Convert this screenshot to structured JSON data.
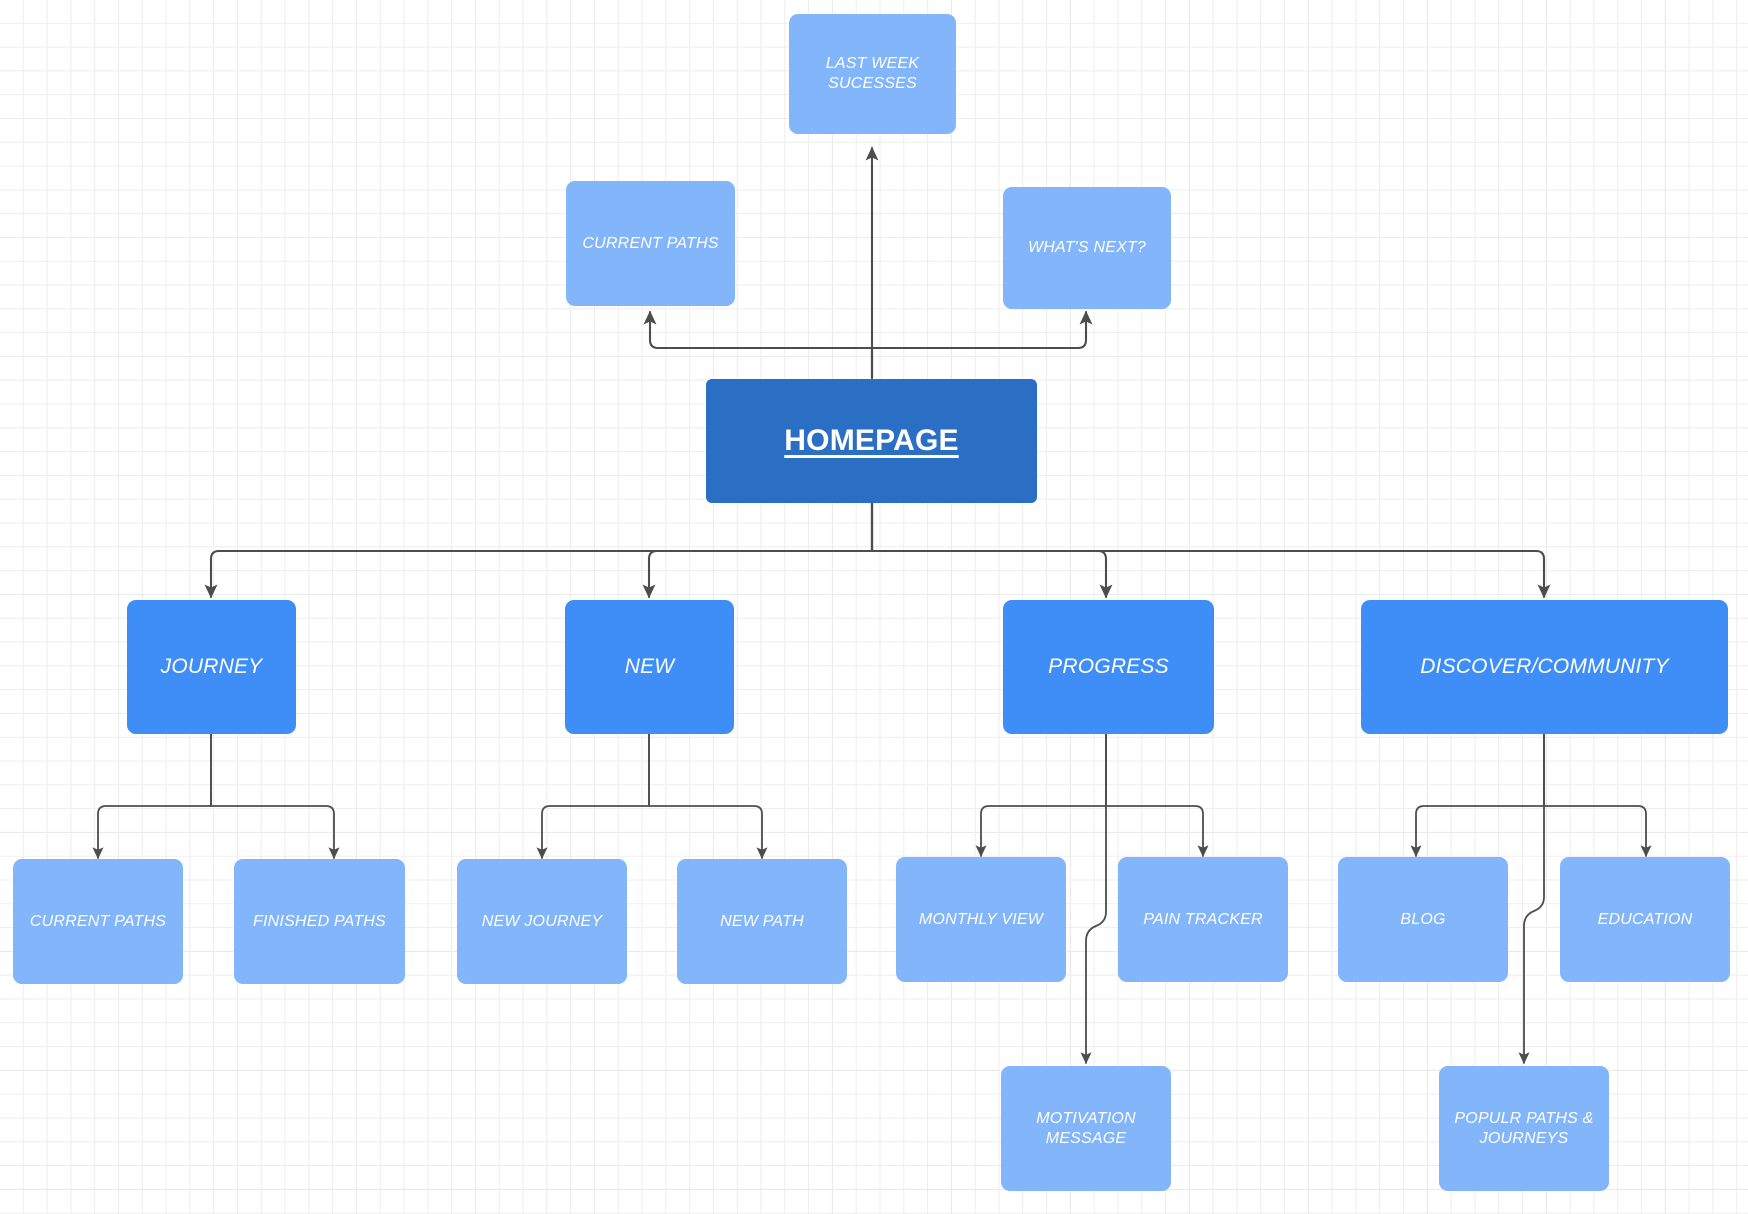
{
  "diagram": {
    "type": "sitemap-flowchart",
    "background": "#ffffff",
    "grid_color": "#ededed",
    "grid_major_color": "#dcdcdc",
    "colors": {
      "root": "#2a6fc4",
      "main": "#3f8ef7",
      "leaf": "#82b5fa",
      "connector": "#4d4d4d",
      "text": "#ffffff"
    }
  },
  "nodes": {
    "root": {
      "label": "HOMEPAGE"
    },
    "side": [
      {
        "label": "LAST WEEK SUCESSES"
      },
      {
        "label": "CURRENT PATHS"
      },
      {
        "label": "WHAT'S NEXT?"
      }
    ],
    "main": [
      {
        "label": "JOURNEY"
      },
      {
        "label": "NEW"
      },
      {
        "label": "PROGRESS"
      },
      {
        "label": "DISCOVER/COMMUNITY"
      }
    ],
    "leaves": [
      {
        "label": "CURRENT PATHS"
      },
      {
        "label": "FINISHED PATHS"
      },
      {
        "label": "NEW JOURNEY"
      },
      {
        "label": "NEW PATH"
      },
      {
        "label": "MONTHLY VIEW"
      },
      {
        "label": "PAIN TRACKER"
      },
      {
        "label": "BLOG"
      },
      {
        "label": "EDUCATION"
      },
      {
        "label": "MOTIVATION MESSAGE"
      },
      {
        "label": "POPULR PATHS & JOURNEYS"
      }
    ]
  }
}
